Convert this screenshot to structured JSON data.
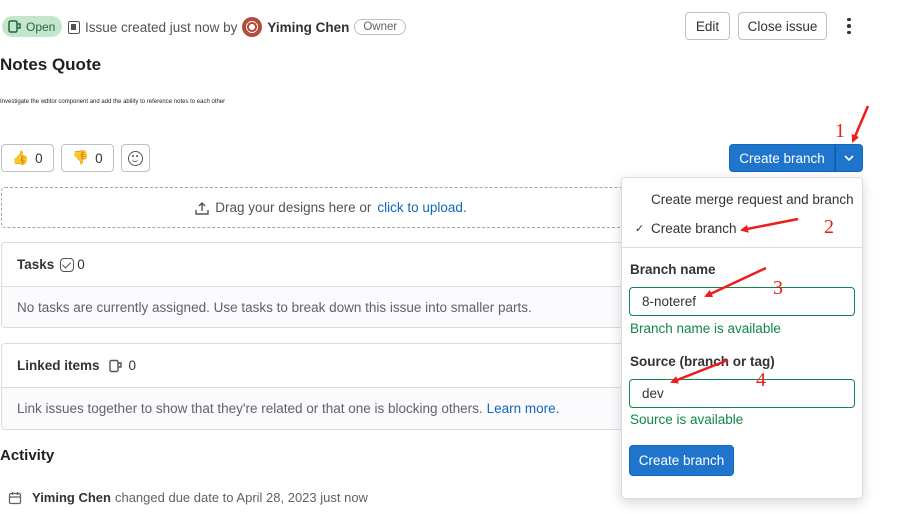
{
  "header": {
    "status": "Open",
    "created_text": "Issue created just now by",
    "author": "Yiming Chen",
    "role_badge": "Owner",
    "edit_label": "Edit",
    "close_label": "Close issue"
  },
  "issue": {
    "title": "Notes Quote",
    "description": "Investigate the wditor component and add the ability to reference notes to each other"
  },
  "awards": {
    "thumbs_up_count": "0",
    "thumbs_down_count": "0"
  },
  "create_branch": {
    "button_label": "Create branch"
  },
  "upload": {
    "prompt": "Drag your designs here or",
    "link": "click to upload",
    "suffix": "."
  },
  "tasks": {
    "label": "Tasks",
    "count": "0",
    "empty_text": "No tasks are currently assigned. Use tasks to break down this issue into smaller parts."
  },
  "linked_items": {
    "label": "Linked items",
    "count": "0",
    "empty_text": "Link issues together to show that they're related or that one is blocking others.",
    "learn_more": "Learn more."
  },
  "activity": {
    "heading": "Activity",
    "entry_author": "Yiming Chen",
    "entry_text": "changed due date to April 28, 2023 just now"
  },
  "dropdown": {
    "option_merge_request": "Create merge request and branch",
    "option_branch": "Create branch",
    "selected_check": "✓",
    "branch_name_label": "Branch name",
    "branch_name_value": "8-noteref",
    "branch_name_status": "Branch name is available",
    "source_label": "Source (branch or tag)",
    "source_value": "dev",
    "source_status": "Source is available",
    "submit_label": "Create branch"
  },
  "annotations": {
    "numbers": [
      "1",
      "2",
      "3",
      "4"
    ],
    "color": "#ee1c1c"
  },
  "colors": {
    "primary": "#1f75cb",
    "success": "#108548",
    "open_badge_bg": "#c3e6cd"
  }
}
